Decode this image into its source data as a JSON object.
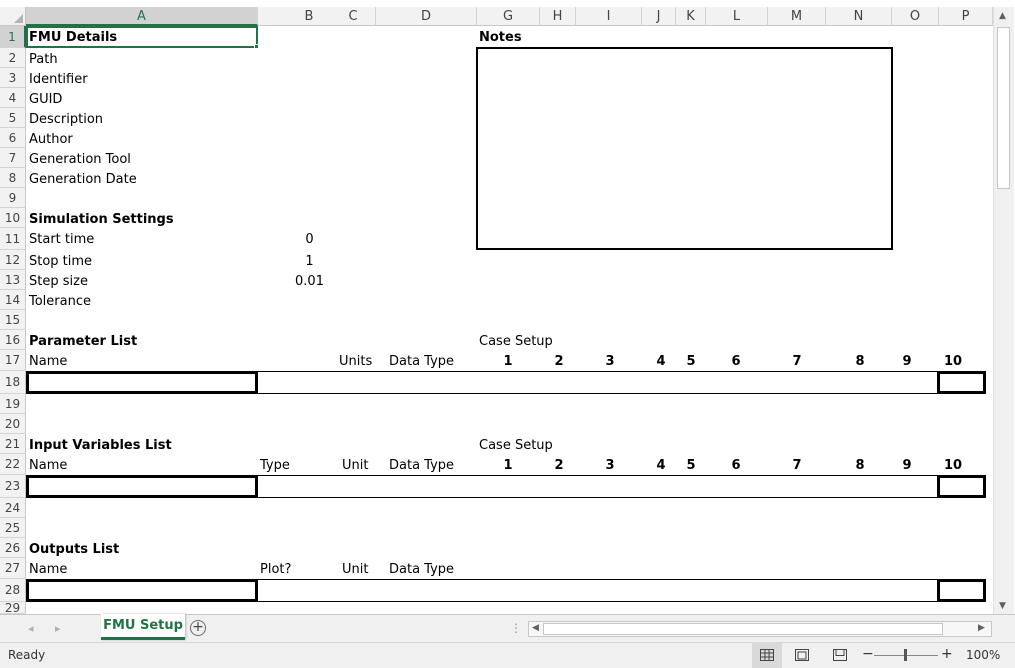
{
  "columns": [
    "A",
    "B",
    "C",
    "D",
    "G",
    "H",
    "I",
    "J",
    "K",
    "L",
    "M",
    "N",
    "O",
    "P"
  ],
  "rows": [
    "1",
    "2",
    "3",
    "4",
    "5",
    "6",
    "7",
    "8",
    "9",
    "10",
    "11",
    "12",
    "13",
    "14",
    "15",
    "16",
    "17",
    "18",
    "19",
    "20",
    "21",
    "22",
    "23",
    "24",
    "25",
    "26",
    "27",
    "28",
    "29"
  ],
  "cells": {
    "a1": "FMU Details",
    "a2": "Path",
    "a3": "Identifier",
    "a4": "GUID",
    "a5": "Description",
    "a6": "Author",
    "a7": "Generation Tool",
    "a8": "Generation Date",
    "a10": "Simulation Settings",
    "a11": "Start time",
    "b11": "0",
    "a12": "Stop time",
    "b12": "1",
    "a13": "Step size",
    "b13": "0.01",
    "a14": "Tolerance",
    "g1": "Notes",
    "a16": "Parameter List",
    "g16": "Case Setup",
    "a17": "Name",
    "c17": "Units",
    "d17": "Data Type",
    "a21": "Input Variables List",
    "g21": "Case Setup",
    "a22": "Name",
    "b22": "Type",
    "c22": "Unit",
    "d22": "Data Type",
    "a26": "Outputs List",
    "a27": "Name",
    "b27": "Plot?",
    "c27": "Unit",
    "d27": "Data Type"
  },
  "case_numbers": [
    "1",
    "2",
    "3",
    "4",
    "5",
    "6",
    "7",
    "8",
    "9",
    "10"
  ],
  "sheet_tab": "FMU Setup",
  "status": {
    "ready": "Ready",
    "zoom": "100%",
    "zoom_minus": "−",
    "zoom_plus": "+"
  },
  "colors": {
    "excel_green": "#217346",
    "header_bg": "#f2f2f2",
    "gridline": "#d4d4d4"
  },
  "icons": {
    "add_sheet": "plus-circle-icon",
    "normal_view": "normal-view-icon",
    "page_layout": "page-layout-icon",
    "page_break": "page-break-icon"
  }
}
